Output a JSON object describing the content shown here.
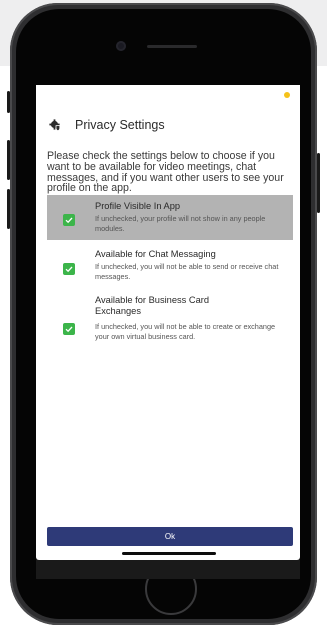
{
  "modal": {
    "title": "Privacy Settings",
    "intro": "Please check the settings below to choose if you want to be available for video meetings, chat messages, and if you want other users to see your profile on the app.",
    "settings": [
      {
        "title": "Profile Visible In App",
        "description": "If unchecked, your profile will not show in any people modules.",
        "checked": true,
        "highlighted": true
      },
      {
        "title": "Available for Chat Messaging",
        "description": "If unchecked, you will not be able to send or receive chat messages.",
        "checked": true,
        "highlighted": false
      },
      {
        "title": "Available for Business Card Exchanges",
        "description": "If unchecked, you will not be able to create or exchange your own virtual business card.",
        "checked": true,
        "highlighted": false
      }
    ],
    "ok_label": "Ok"
  },
  "icons": {
    "title_icon": "settings-shield-icon",
    "check_icon": "checkbox-checked-icon"
  },
  "colors": {
    "primary_button": "#2e3a78",
    "checkbox": "#3cb54a",
    "highlight": "#b3b3b3",
    "status_dot": "#f5c21a"
  }
}
